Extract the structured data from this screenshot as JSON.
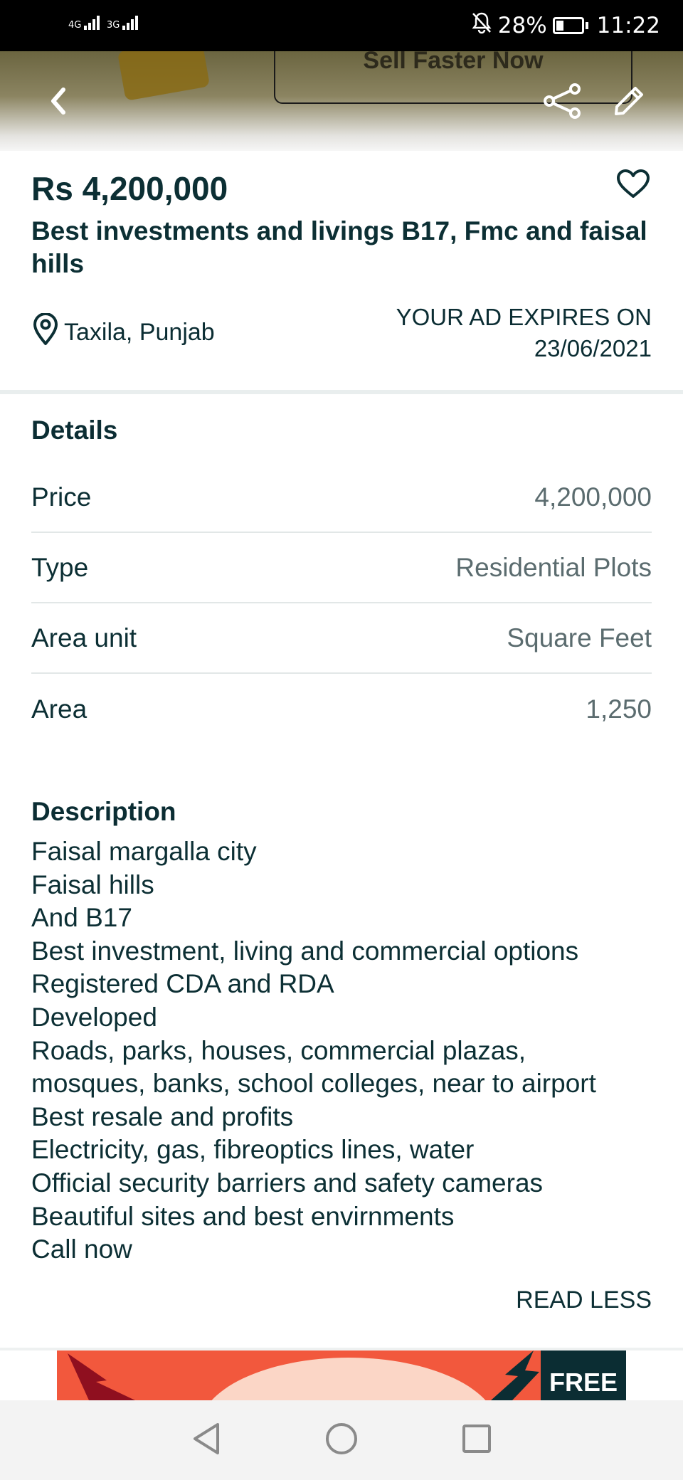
{
  "status_bar": {
    "network_1": "4G",
    "network_2": "3G",
    "battery_percent": "28%",
    "battery_level": 0.28,
    "time": "11:22"
  },
  "hero": {
    "cta_label": "Sell Faster Now"
  },
  "listing": {
    "price": "Rs 4,200,000",
    "title": "Best investments and livings B17, Fmc and faisal hills",
    "location": "Taxila, Punjab",
    "expiry_label": "YOUR AD EXPIRES ON",
    "expiry_date": "23/06/2021"
  },
  "details": {
    "heading": "Details",
    "rows": [
      {
        "label": "Price",
        "value": "4,200,000"
      },
      {
        "label": "Type",
        "value": "Residential Plots"
      },
      {
        "label": "Area unit",
        "value": "Square Feet"
      },
      {
        "label": "Area",
        "value": "1,250"
      }
    ]
  },
  "description": {
    "heading": "Description",
    "lines": [
      "Faisal margalla city",
      "Faisal hills",
      "And B17",
      "Best investment, living and commercial options",
      "Registered CDA and RDA",
      "Developed",
      "Roads, parks, houses, commercial plazas,",
      "mosques, banks, school colleges, near to airport",
      "Best resale and profits",
      "Electricity, gas, fibreoptics lines, water",
      "Official security barriers and safety cameras",
      "Beautiful sites and best envirnments",
      "Call now"
    ],
    "toggle_label": "READ LESS"
  },
  "ad": {
    "badge": "FREE"
  },
  "icons": {
    "back": "chevron-left-icon",
    "share": "share-icon",
    "edit": "pencil-icon",
    "favorite": "heart-icon",
    "location": "location-pin-icon",
    "nav_back": "triangle-back-icon",
    "nav_home": "circle-home-icon",
    "nav_recents": "square-recents-icon"
  },
  "colors": {
    "text_primary": "#0c2f34",
    "text_secondary": "#5b6c6f",
    "ad_accent": "#f2583d"
  }
}
